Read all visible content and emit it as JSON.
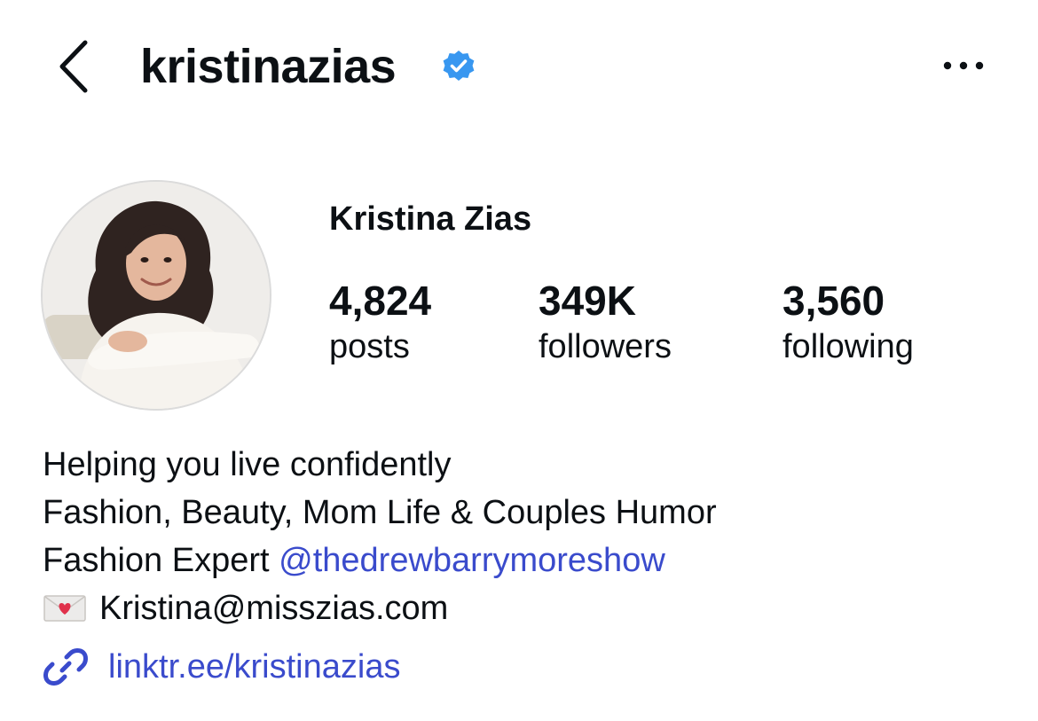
{
  "header": {
    "username": "kristinazias",
    "verified": true,
    "back_icon": "chevron-left-icon",
    "more_icon": "more-horizontal-icon",
    "verified_color": "#3897f0"
  },
  "profile": {
    "display_name": "Kristina Zias",
    "avatar": "profile-photo-avatar"
  },
  "stats": [
    {
      "value": "4,824",
      "label": "posts"
    },
    {
      "value": "349K",
      "label": "followers"
    },
    {
      "value": "3,560",
      "label": "following"
    }
  ],
  "bio": {
    "line1": "Helping you live confidently",
    "line2": "Fashion, Beauty, Mom Life & Couples Humor",
    "line3_prefix": "Fashion Expert ",
    "line3_mention": "@thedrewbarrymoreshow",
    "email": "Kristina@misszias.com",
    "email_icon": "love-letter-envelope-icon"
  },
  "link": {
    "text": "linktr.ee/kristinazias",
    "icon": "link-icon"
  },
  "colors": {
    "text": "#0c1014",
    "link": "#3a4bcc",
    "verified_badge": "#3897f0",
    "background": "#ffffff"
  }
}
